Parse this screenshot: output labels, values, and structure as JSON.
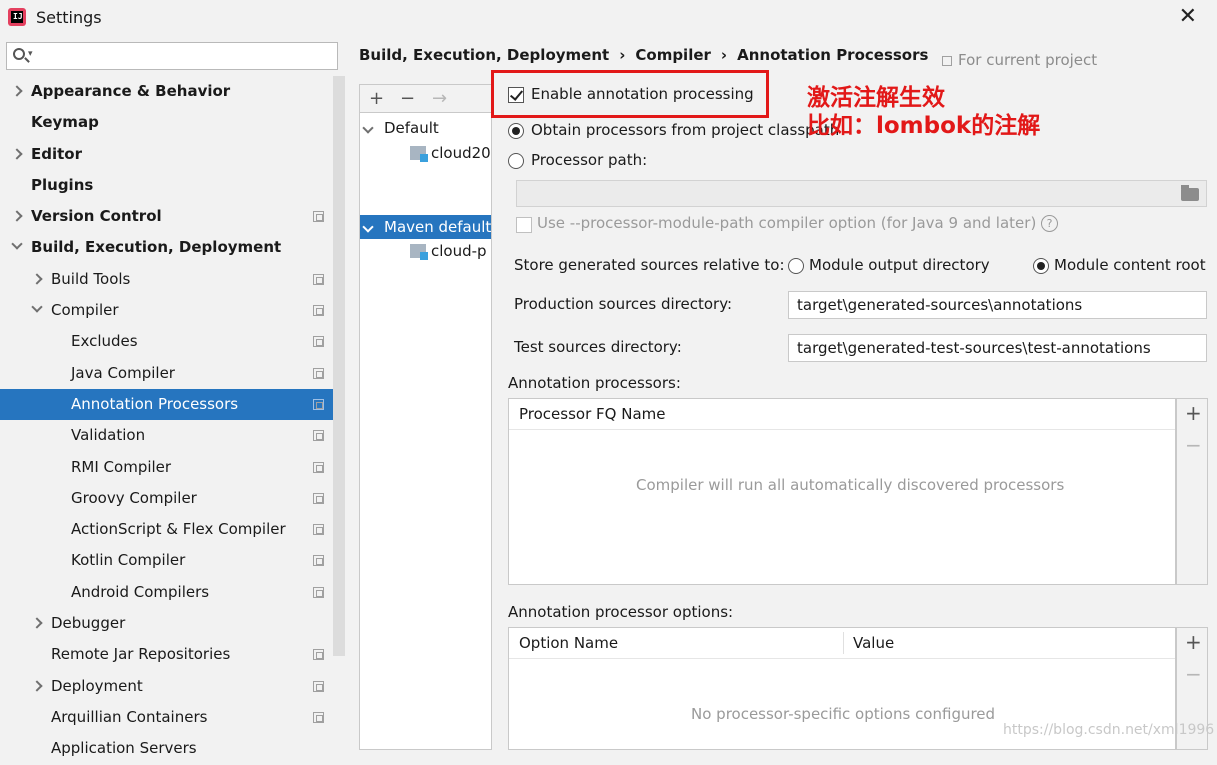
{
  "window": {
    "title": "Settings",
    "icon_text": "IJ"
  },
  "search": {
    "placeholder": ""
  },
  "sidebar": {
    "items": [
      {
        "label": "Appearance & Behavior",
        "bold": true,
        "indent": 0,
        "arrow": "right",
        "copy": false
      },
      {
        "label": "Keymap",
        "bold": true,
        "indent": 0,
        "arrow": "none",
        "copy": false
      },
      {
        "label": "Editor",
        "bold": true,
        "indent": 0,
        "arrow": "right",
        "copy": false
      },
      {
        "label": "Plugins",
        "bold": true,
        "indent": 0,
        "arrow": "none",
        "copy": false
      },
      {
        "label": "Version Control",
        "bold": true,
        "indent": 0,
        "arrow": "right",
        "copy": true
      },
      {
        "label": "Build, Execution, Deployment",
        "bold": true,
        "indent": 0,
        "arrow": "down",
        "copy": false
      },
      {
        "label": "Build Tools",
        "bold": false,
        "indent": 1,
        "arrow": "right",
        "copy": true
      },
      {
        "label": "Compiler",
        "bold": false,
        "indent": 1,
        "arrow": "down",
        "copy": true
      },
      {
        "label": "Excludes",
        "bold": false,
        "indent": 2,
        "arrow": "none",
        "copy": true
      },
      {
        "label": "Java Compiler",
        "bold": false,
        "indent": 2,
        "arrow": "none",
        "copy": true
      },
      {
        "label": "Annotation Processors",
        "bold": false,
        "indent": 2,
        "arrow": "none",
        "copy": true,
        "selected": true
      },
      {
        "label": "Validation",
        "bold": false,
        "indent": 2,
        "arrow": "none",
        "copy": true
      },
      {
        "label": "RMI Compiler",
        "bold": false,
        "indent": 2,
        "arrow": "none",
        "copy": true
      },
      {
        "label": "Groovy Compiler",
        "bold": false,
        "indent": 2,
        "arrow": "none",
        "copy": true
      },
      {
        "label": "ActionScript & Flex Compiler",
        "bold": false,
        "indent": 2,
        "arrow": "none",
        "copy": true
      },
      {
        "label": "Kotlin Compiler",
        "bold": false,
        "indent": 2,
        "arrow": "none",
        "copy": true
      },
      {
        "label": "Android Compilers",
        "bold": false,
        "indent": 2,
        "arrow": "none",
        "copy": true
      },
      {
        "label": "Debugger",
        "bold": false,
        "indent": 1,
        "arrow": "right",
        "copy": false
      },
      {
        "label": "Remote Jar Repositories",
        "bold": false,
        "indent": 1,
        "arrow": "none",
        "copy": true
      },
      {
        "label": "Deployment",
        "bold": false,
        "indent": 1,
        "arrow": "right",
        "copy": true
      },
      {
        "label": "Arquillian Containers",
        "bold": false,
        "indent": 1,
        "arrow": "none",
        "copy": true
      },
      {
        "label": "Application Servers",
        "bold": false,
        "indent": 1,
        "arrow": "none",
        "copy": false
      }
    ]
  },
  "breadcrumb": {
    "part1": "Build, Execution, Deployment",
    "sep": "›",
    "part2": "Compiler",
    "part3": "Annotation Processors"
  },
  "for_current_project": "For current project",
  "profiles": {
    "toolbar": {
      "add": "+",
      "remove": "−",
      "move": "→"
    },
    "items": [
      {
        "label": "Default",
        "type": "group",
        "expanded": true
      },
      {
        "label": "cloud20",
        "type": "module"
      },
      {
        "label": "Maven default",
        "type": "group",
        "expanded": true,
        "selected": true
      },
      {
        "label": "cloud-p",
        "type": "module"
      }
    ]
  },
  "form": {
    "enable_label": "Enable annotation processing",
    "enable_checked": true,
    "obtain_label": "Obtain processors from project classpath",
    "processor_path_label": "Processor path:",
    "processor_path_value": "",
    "module_path_label": "Use --processor-module-path compiler option (for Java 9 and later)",
    "help_glyph": "?",
    "store_label": "Store generated sources relative to:",
    "module_output_label": "Module output directory",
    "module_content_label": "Module content root",
    "prod_label": "Production sources directory:",
    "prod_value": "target\\generated-sources\\annotations",
    "test_label": "Test sources directory:",
    "test_value": "target\\generated-test-sources\\test-annotations",
    "processors_title": "Annotation processors:",
    "processors_col": "Processor FQ Name",
    "processors_empty": "Compiler will run all automatically discovered processors",
    "options_title": "Annotation processor options:",
    "options_col_name": "Option Name",
    "options_col_value": "Value",
    "options_empty": "No processor-specific options configured",
    "add_glyph": "+",
    "remove_glyph": "−"
  },
  "annotation": {
    "line1": "激活注解生效",
    "line2": "比如：lombok的注解"
  },
  "watermark": "https://blog.csdn.net/xml1996",
  "colors": {
    "selection": "#2675bf",
    "annotation_red": "#e21818"
  }
}
